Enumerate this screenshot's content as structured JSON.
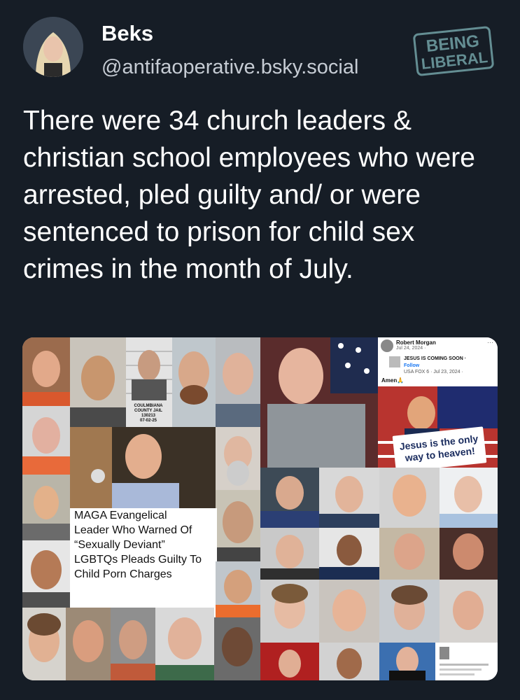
{
  "author": {
    "name": "Beks",
    "handle": "@antifaoperative.bsky.social"
  },
  "watermark": {
    "line1": "BEING",
    "line2": "LIBERAL",
    "color": "#6f9ea3"
  },
  "post": {
    "text": "There were 34 church leaders & christian school employees who were arrested, pled guilty and/ or were sentenced to prison for child sex crimes in the month of July."
  },
  "collage": {
    "caption_lines": [
      "MAGA Evangelical",
      "Leader Who Warned Of",
      "“Sexually Deviant”",
      "LGBTQs Pleads Guilty To",
      "Child Porn Charges"
    ],
    "jail_label": "COULMBIANA COUNTY JAIL",
    "jail_id": "130213",
    "jail_date": "07-02-25",
    "facebook": {
      "name": "Robert Morgan",
      "date": "Jul 24, 2024 · ",
      "inner_title": "JESUS IS COMING SOON ·",
      "follow": "Follow",
      "inner_source": "USA FOX 6 · Jul 23, 2024 · ",
      "amen": "Amen🙏",
      "more": "···"
    },
    "sign_line1": "Jesus is the only",
    "sign_line2": "way to heaven!"
  }
}
